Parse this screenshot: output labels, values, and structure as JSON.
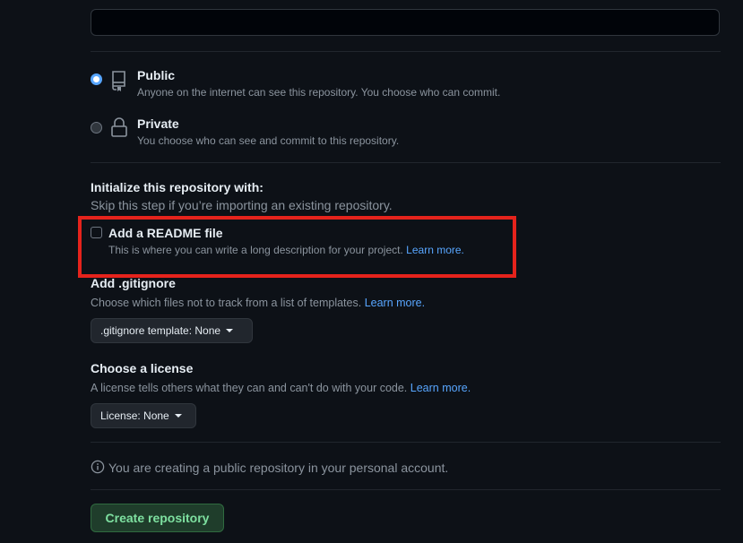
{
  "description": {
    "value": "",
    "placeholder": ""
  },
  "visibility": {
    "public": {
      "label": "Public",
      "description": "Anyone on the internet can see this repository. You choose who can commit."
    },
    "private": {
      "label": "Private",
      "description": "You choose who can see and commit to this repository."
    }
  },
  "initialize": {
    "title": "Initialize this repository with:",
    "subtitle": "Skip this step if you’re importing an existing repository."
  },
  "readme": {
    "label": "Add a README file",
    "description": "This is where you can write a long description for your project.",
    "link": "Learn more."
  },
  "gitignore": {
    "title": "Add .gitignore",
    "description": "Choose which files not to track from a list of templates.",
    "link": "Learn more.",
    "button": ".gitignore template: None"
  },
  "license": {
    "title": "Choose a license",
    "description": "A license tells others what they can and can't do with your code.",
    "link": "Learn more.",
    "button": "License: None"
  },
  "notice": "You are creating a public repository in your personal account.",
  "create_button": "Create repository",
  "colors": {
    "background": "#0d1117",
    "accent_link": "#58a6ff",
    "highlight_box": "#e5231c",
    "create_button_text": "#7ee0a0"
  },
  "icons": {
    "public": "repo-icon",
    "private": "lock-icon",
    "notice": "info-icon"
  }
}
